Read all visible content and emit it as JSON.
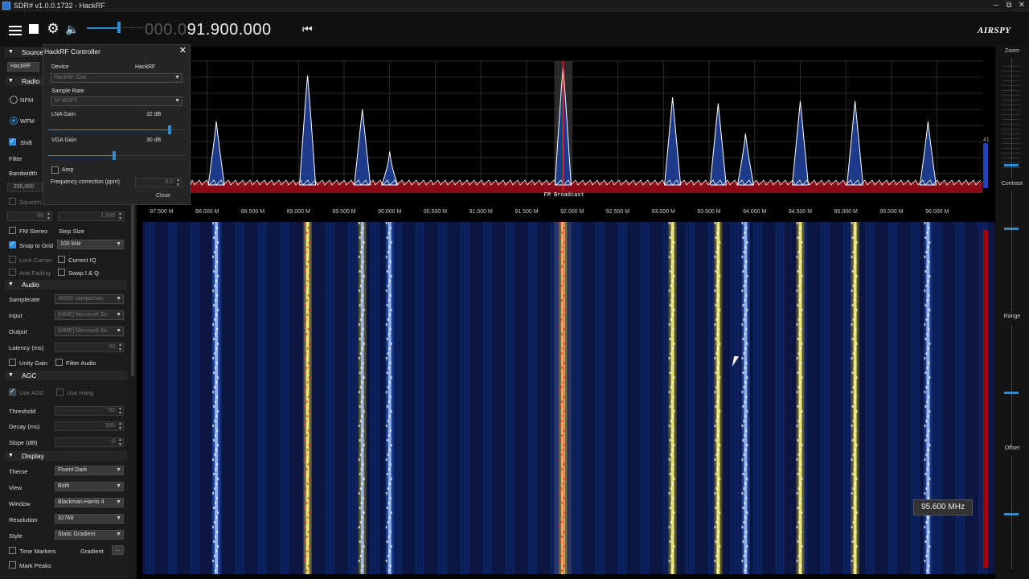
{
  "window": {
    "title": "SDR# v1.0.0.1732 - HackRF",
    "minimize": "‒",
    "maximize": "⧉",
    "close": "✕"
  },
  "toolbar": {
    "freq_dim": "000.0",
    "freq_bright": "91.900.000",
    "logo": "AIRSPY"
  },
  "left_panel": {
    "source_section": "Source",
    "source_value": "HackRF",
    "radio_section": "Radio",
    "nfm": "NFM",
    "wfm": "WFM",
    "shift": "Shift",
    "filter": "Filter",
    "bandwidth": "Bandwidth",
    "bandwidth_value": "200,000",
    "squelch": "Squelch",
    "spin_a": "50",
    "spin_b": "1,000",
    "fm_stereo": "FM Stereo",
    "step_size": "Step Size",
    "snap_to_grid": "Snap to Grid",
    "step_value": "100 kHz",
    "lock_carrier": "Lock Carrier",
    "correct_iq": "Correct IQ",
    "anti_fading": "Anti-Fading",
    "swap_iq": "Swap I & Q",
    "audio_section": "Audio",
    "samplerate": "Samplerate",
    "samplerate_value": "48000 sample/sec",
    "input": "Input",
    "input_value": "[MME] Microsoft So",
    "output": "Output",
    "output_value": "[MME] Microsoft So",
    "latency": "Latency (ms)",
    "latency_value": "50",
    "unity_gain": "Unity Gain",
    "filter_audio": "Filter Audio",
    "agc_section": "AGC",
    "use_agc": "Use AGC",
    "use_hang": "Use Hang",
    "threshold": "Threshold",
    "threshold_value": "-50",
    "decay": "Decay (ms)",
    "decay_value": "500",
    "slope": "Slope (dB)",
    "slope_value": "0",
    "display_section": "Display",
    "theme": "Theme",
    "theme_value": "Fluent Dark",
    "view": "View",
    "view_value": "Both",
    "window": "Window",
    "window_value": "Blackman-Harris 4",
    "resolution": "Resolution",
    "resolution_value": "32768",
    "style": "Style",
    "style_value": "Static Gradient",
    "time_markers": "Time Markers",
    "gradient": "Gradient",
    "gradient_btn": "...",
    "mark_peaks": "Mark Peaks"
  },
  "popup": {
    "title": "HackRF Controller",
    "device_label": "Device",
    "device_name": "HackRF",
    "device_value": "HackRF One",
    "sample_rate_label": "Sample Rate",
    "sample_rate_value": "10 MSPS",
    "lna_label": "LNA Gain",
    "lna_value": "32 dB",
    "lna_level": 0.89,
    "vga_label": "VGA Gain",
    "vga_value": "30 dB",
    "vga_level": 0.48,
    "amp_label": "Amp",
    "freq_corr_label": "Frequency correction (ppm)",
    "freq_corr_value": "0.0",
    "close_label": "Close"
  },
  "spectrum": {
    "band_label": "FM Broadcast",
    "scale_value": "41",
    "freq_labels": [
      "87.500 M",
      "88.000 M",
      "88.500 M",
      "89.000 M",
      "89.500 M",
      "90.000 M",
      "90.500 M",
      "91.000 M",
      "91.500 M",
      "92.000 M",
      "92.500 M",
      "93.000 M",
      "93.500 M",
      "94.000 M",
      "94.500 M",
      "95.000 M",
      "95.500 M",
      "96.000 M"
    ],
    "freq_start_mhz": 87.5,
    "freq_step_mhz": 0.5,
    "mhz_per_div": 0.5,
    "center_mhz": 91.9,
    "stations_mhz": [
      88.1,
      89.1,
      89.7,
      90.0,
      91.9,
      93.1,
      93.6,
      93.9,
      94.5,
      95.1,
      95.9
    ],
    "station_levels": [
      0.5,
      0.88,
      0.6,
      0.25,
      0.95,
      0.7,
      0.65,
      0.4,
      0.67,
      0.67,
      0.5
    ],
    "colors": {
      "station_fill": "#1e3a8a",
      "noise_fill": "#8b0a1a",
      "line": "#ffffff",
      "grid": "#2a2a2a"
    }
  },
  "waterfall": {
    "hover_freq": "95.600 MHz"
  },
  "right_panel": {
    "zoom": "Zoom",
    "contrast": "Contrast",
    "range": "Range",
    "offset": "Offset",
    "zoom_level": 0.12,
    "contrast_level": 0.7,
    "range_level": 0.45,
    "offset_level": 0.5
  }
}
